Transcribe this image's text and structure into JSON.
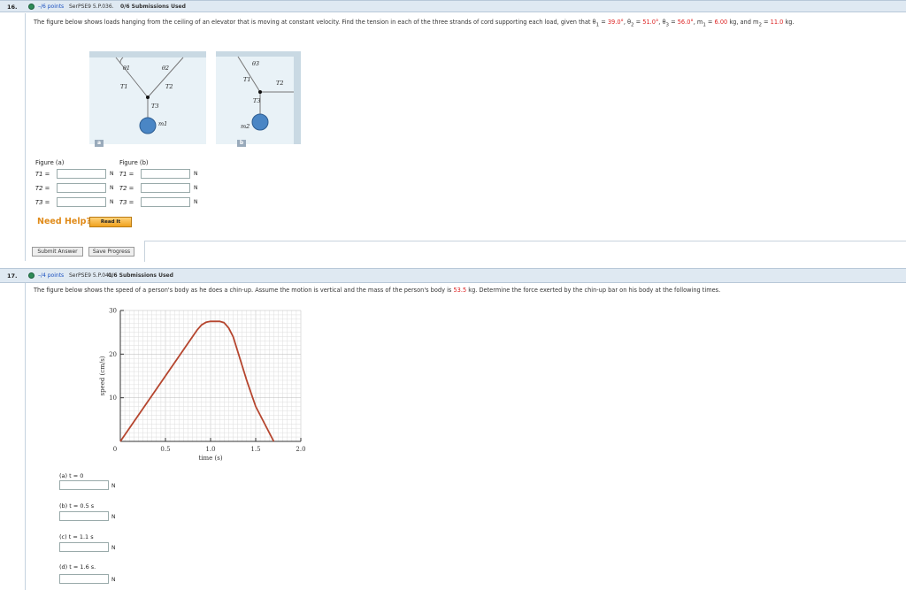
{
  "q16": {
    "number": "16.",
    "points": "–/6 points",
    "source": "SerPSE9 5.P.036.",
    "submissions": "0/6 Submissions Used",
    "text_pre": "The figure below shows loads hanging from the ceiling of an elevator that is moving at constant velocity. Find the tension in each of the three strands of cord supporting each load, given that θ",
    "theta1": "39.0°",
    "theta2": "51.0°",
    "theta3": "56.0°",
    "m1": "6.00",
    "m2": "11.0",
    "figA": {
      "tag": "a",
      "theta1": "θ1",
      "theta2": "θ2",
      "T1": "T1",
      "T2": "T2",
      "T3": "T3",
      "m": "m1"
    },
    "figB": {
      "tag": "b",
      "theta3": "θ3",
      "T1": "T1",
      "T2": "T2",
      "T3": "T3",
      "m": "m2"
    },
    "colA_title": "Figure (a)",
    "colB_title": "Figure (b)",
    "rows": [
      {
        "label": "T1 =",
        "unit": "N"
      },
      {
        "label": "T2 =",
        "unit": "N"
      },
      {
        "label": "T3 =",
        "unit": "N"
      }
    ],
    "need_help": "Need Help?",
    "read_it": "Read It",
    "submit": "Submit Answer",
    "save": "Save Progress"
  },
  "q17": {
    "number": "17.",
    "points": "–/4 points",
    "source": "SerPSE9 5.P.041.",
    "submissions": "0/6 Submissions Used",
    "text_pre": "The figure below shows the speed of a person's body as he does a chin-up. Assume the motion is vertical and the mass of the person's body is",
    "mass": "53.5",
    "text_post": "kg. Determine the force exerted by the chin-up bar on his body at the following times.",
    "parts": [
      {
        "label": "(a)   t = 0",
        "unit": "N"
      },
      {
        "label": "(b)   t = 0.5 s",
        "unit": "N"
      },
      {
        "label": "(c)   t = 1.1 s",
        "unit": "N"
      },
      {
        "label": "(d)   t = 1.6 s.",
        "unit": "N"
      }
    ]
  },
  "chart_data": {
    "type": "line",
    "xlabel": "time (s)",
    "ylabel": "speed (cm/s)",
    "xlim": [
      0,
      2.0
    ],
    "ylim": [
      0,
      30
    ],
    "x_ticks": [
      "0.5",
      "1.0",
      "1.5",
      "2.0"
    ],
    "y_ticks": [
      "30",
      "20",
      "10"
    ],
    "origin_label": "0",
    "grid": true,
    "series": [
      {
        "color": "#b5452e",
        "x": [
          0,
          0.8,
          0.85,
          0.9,
          0.95,
          1.0,
          1.05,
          1.1,
          1.15,
          1.2,
          1.25,
          1.4,
          1.5,
          1.7
        ],
        "y": [
          0,
          24.0,
          25.5,
          26.7,
          27.3,
          27.5,
          27.5,
          27.5,
          27.2,
          26.0,
          24.0,
          14.0,
          8.0,
          0
        ]
      }
    ]
  }
}
